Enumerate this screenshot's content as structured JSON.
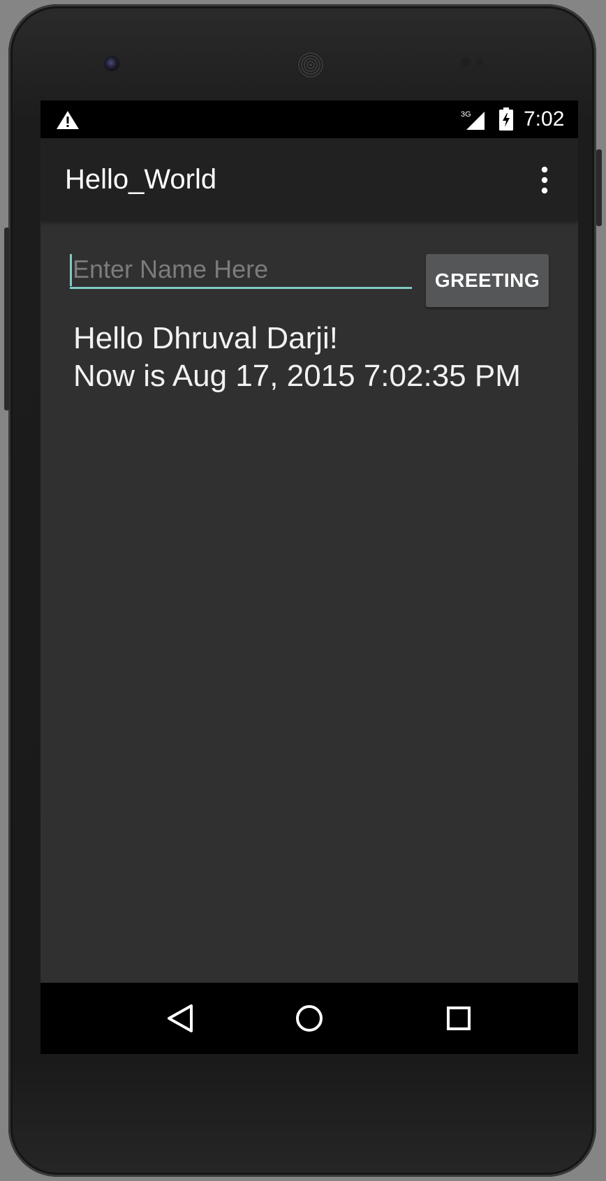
{
  "status_bar": {
    "warning_icon": "warning-triangle-icon",
    "network_type": "3G",
    "signal_icon": "cellular-signal-icon",
    "battery_icon": "battery-charging-icon",
    "time": "7:02"
  },
  "app_bar": {
    "title": "Hello_World",
    "overflow_icon": "more-vert-icon"
  },
  "form": {
    "name_input": {
      "value": "",
      "placeholder": "Enter Name Here"
    },
    "greeting_button_label": "GREETING",
    "output_line1": "Hello Dhruval Darji!",
    "output_line2": "Now is Aug 17, 2015 7:02:35 PM"
  },
  "nav_bar": {
    "back_icon": "back-triangle-icon",
    "home_icon": "home-circle-icon",
    "recents_icon": "recents-square-icon"
  },
  "colors": {
    "accent": "#80cbc4",
    "app_bar": "#212121",
    "background": "#303030",
    "button": "#555657"
  }
}
